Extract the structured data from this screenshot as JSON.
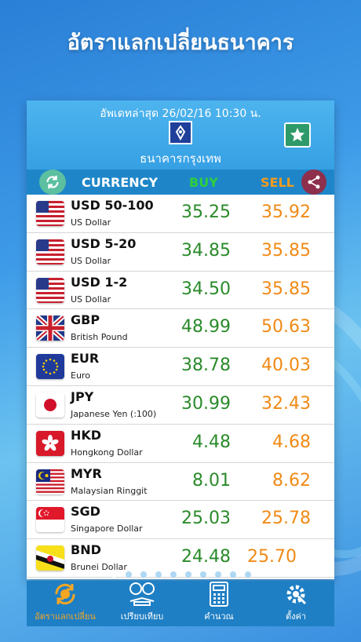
{
  "app": {
    "title": "อัตราแลกเปลี่ยนธนาคาร"
  },
  "header": {
    "updated": "อัพเดทล่าสุด 26/02/16 10:30 น.",
    "bank_name": "ธนาคารกรุงเทพ"
  },
  "columns": {
    "currency": "CURRENCY",
    "buy": "BUY",
    "sell": "SELL"
  },
  "rates": [
    {
      "code": "USD 50-100",
      "name": "US Dollar",
      "buy": "35.25",
      "sell": "35.92",
      "flag": "us-flag"
    },
    {
      "code": "USD 5-20",
      "name": "US Dollar",
      "buy": "34.85",
      "sell": "35.85",
      "flag": "us-flag"
    },
    {
      "code": "USD 1-2",
      "name": "US Dollar",
      "buy": "34.50",
      "sell": "35.85",
      "flag": "us-flag"
    },
    {
      "code": "GBP",
      "name": "British Pound",
      "buy": "48.99",
      "sell": "50.63",
      "flag": "uk-flag"
    },
    {
      "code": "EUR",
      "name": "Euro",
      "buy": "38.78",
      "sell": "40.03",
      "flag": "eu-flag"
    },
    {
      "code": "JPY",
      "name": "Japanese Yen (:100)",
      "buy": "30.99",
      "sell": "32.43",
      "flag": "japan-flag"
    },
    {
      "code": "HKD",
      "name": "Hongkong Dollar",
      "buy": "4.48",
      "sell": "4.68",
      "flag": "hongkong-flag"
    },
    {
      "code": "MYR",
      "name": "Malaysian Ringgit",
      "buy": "8.01",
      "sell": "8.62",
      "flag": "malaysia-flag"
    },
    {
      "code": "SGD",
      "name": "Singapore Dollar",
      "buy": "25.03",
      "sell": "25.78",
      "flag": "singapore-flag"
    },
    {
      "code": "BND",
      "name": "Brunei Dollar",
      "buy": "24.48",
      "sell": "25.70",
      "flag": "brunei-flag"
    }
  ],
  "pager": {
    "pages": 10,
    "current": 1
  },
  "tabs": [
    {
      "label": "อัตราแลกเปลี่ยน",
      "icon": "currency-exchange-icon",
      "active": true
    },
    {
      "label": "เปรียบเทียบ",
      "icon": "compare-icon",
      "active": false
    },
    {
      "label": "คำนวณ",
      "icon": "calculator-icon",
      "active": false
    },
    {
      "label": "ตั้งค่า",
      "icon": "settings-icon",
      "active": false
    }
  ],
  "colors": {
    "buy": "#2a8a2a",
    "sell": "#f08a16",
    "accent": "#1f7fc4",
    "active_tab": "#f5a623"
  }
}
